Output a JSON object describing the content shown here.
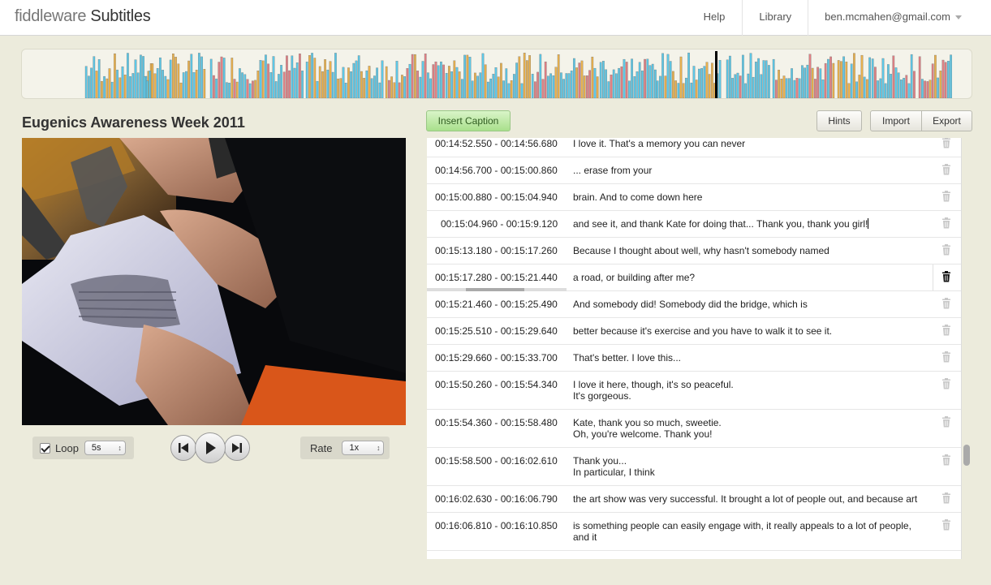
{
  "app": {
    "brand_light": "fiddleware",
    "brand_main": " Subtitles"
  },
  "nav": {
    "help": "Help",
    "library": "Library",
    "user": "ben.mcmahen@gmail.com"
  },
  "colors": {
    "bar_orange": "#e8b04c",
    "bar_blue": "#5cc7e6",
    "bar_red": "#e07f84",
    "accent_green": "#a9e08c"
  },
  "video": {
    "title": "Eugenics Awareness Week 2011"
  },
  "controls": {
    "loop_label": "Loop",
    "loop_checked": true,
    "loop_value": "5s",
    "rate_label": "Rate",
    "rate_value": "1x"
  },
  "toolbar": {
    "insert_caption": "Insert Caption",
    "hints": "Hints",
    "import": "Import",
    "export": "Export"
  },
  "captions": [
    {
      "time": "00:14:52.550 - 00:14:56.680",
      "text": "I love it. That's a memory you can never"
    },
    {
      "time": "00:14:56.700 - 00:15:00.860",
      "text": "... erase from your"
    },
    {
      "time": "00:15:00.880 - 00:15:04.940",
      "text": "brain. And to come down here"
    },
    {
      "time": "00:15:04.960 - 00:15:9.120",
      "text": "and see it, and thank Kate for doing that... Thank you, thank you girl!"
    },
    {
      "time": "00:15:13.180 - 00:15:17.260",
      "text": "Because I thought about well, why hasn't somebody named"
    },
    {
      "time": "00:15:17.280 - 00:15:21.440",
      "text": "a road, or building after me?"
    },
    {
      "time": "00:15:21.460 - 00:15:25.490",
      "text": "And somebody did! Somebody did the bridge, which is"
    },
    {
      "time": "00:15:25.510 - 00:15:29.640",
      "text": "better because it's exercise and you have to walk it to see it."
    },
    {
      "time": "00:15:29.660 - 00:15:33.700",
      "text": "That's better. I love this..."
    },
    {
      "time": "00:15:50.260 - 00:15:54.340",
      "text": "I love it here, though, it's so peaceful.",
      "text2": "It's gorgeous."
    },
    {
      "time": "00:15:54.360 - 00:15:58.480",
      "text": "Kate, thank you so much, sweetie.",
      "text2": "Oh, you're welcome. Thank you!"
    },
    {
      "time": "00:15:58.500 - 00:16:02.610",
      "text": "Thank you...",
      "text2": "In particular, I think"
    },
    {
      "time": "00:16:02.630 - 00:16:06.790",
      "text": "the art show was very successful. It brought a lot of people out, and because art"
    },
    {
      "time": "00:16:06.810 - 00:16:10.850",
      "text": "is something people can easily engage with, it really appeals to a lot of people,",
      "text2": "and it"
    }
  ]
}
